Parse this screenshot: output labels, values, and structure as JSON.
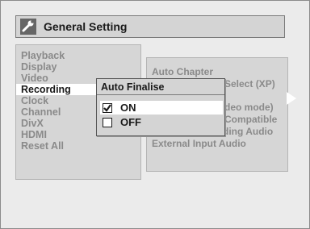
{
  "title": "General Setting",
  "icons": {
    "title": "wrench-icon",
    "check": "check-icon",
    "arrow": "arrow-right-icon"
  },
  "menu": [
    {
      "label": "Playback",
      "active": false
    },
    {
      "label": "Display",
      "active": false
    },
    {
      "label": "Video",
      "active": false
    },
    {
      "label": "Recording",
      "active": true
    },
    {
      "label": "Clock",
      "active": false
    },
    {
      "label": "Channel",
      "active": false
    },
    {
      "label": "DivX",
      "active": false
    },
    {
      "label": "HDMI",
      "active": false
    },
    {
      "label": "Reset All",
      "active": false
    }
  ],
  "submenu": [
    {
      "label": "Auto Chapter"
    },
    {
      "label": "Select (XP)"
    },
    {
      "label": "deo mode)"
    },
    {
      "label": "Compatible"
    },
    {
      "label": "Bilingual Recording Audio"
    },
    {
      "label": "External Input Audio"
    }
  ],
  "dialog": {
    "title": "Auto Finalise",
    "options": [
      {
        "label": "ON",
        "checked": true,
        "selected": true
      },
      {
        "label": "OFF",
        "checked": false,
        "selected": false
      }
    ]
  },
  "colors": {
    "highlight": "#ffffff",
    "text": "#1a1a1a",
    "dim_text": "#8a8a8a",
    "panel": "#d6d6d6"
  }
}
